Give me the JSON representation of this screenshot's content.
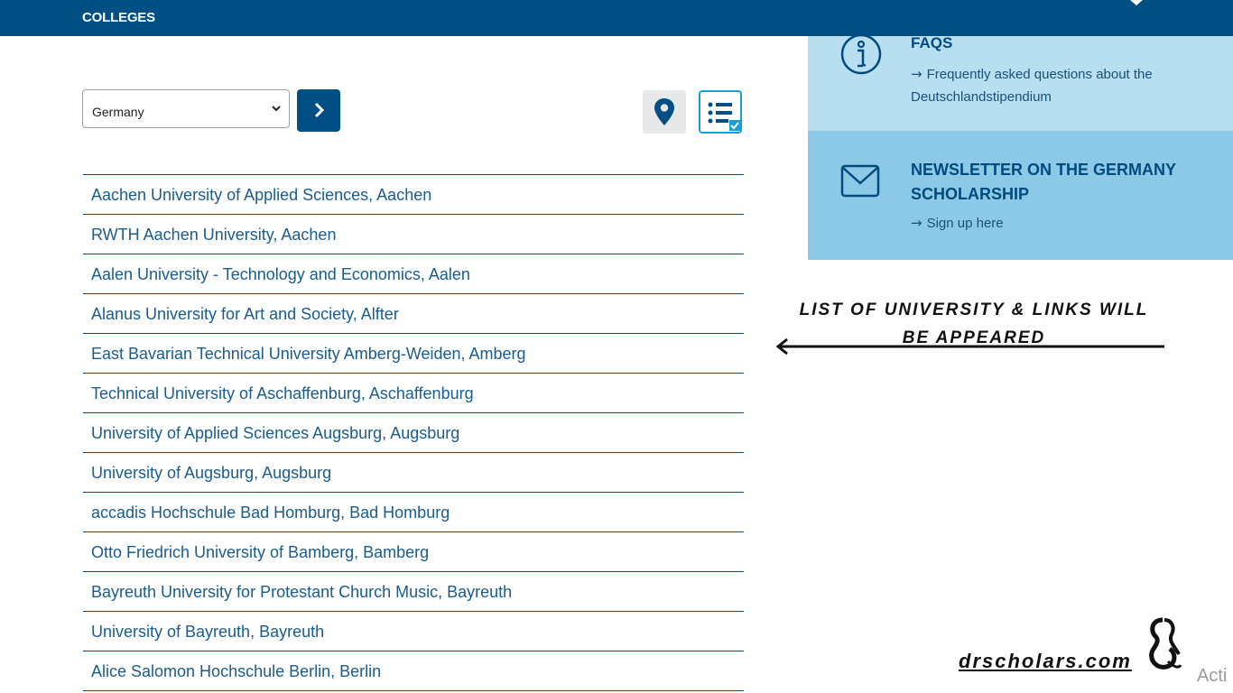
{
  "header": {
    "title": "COLLEGES"
  },
  "filter": {
    "selected": "Germany"
  },
  "universities": [
    "Aachen University of Applied Sciences, Aachen",
    "RWTH Aachen University, Aachen",
    "Aalen University - Technology and Economics, Aalen",
    "Alanus University for Art and Society, Alfter",
    "East Bavarian Technical University Amberg-Weiden, Amberg",
    "Technical University of Aschaffenburg, Aschaffenburg",
    "University of Applied Sciences Augsburg, Augsburg",
    "University of Augsburg, Augsburg",
    "accadis Hochschule Bad Homburg, Bad Homburg",
    "Otto Friedrich University of Bamberg, Bamberg",
    "Bayreuth University for Protestant Church Music, Bayreuth",
    "University of Bayreuth, Bayreuth",
    "Alice Salomon Hochschule Berlin, Berlin"
  ],
  "sidebar": {
    "faq": {
      "title": "FAQS",
      "link": "Frequently asked questions about the Deutschlandstipendium"
    },
    "newsletter": {
      "title": "NEWSLETTER ON THE GERMANY SCHOLARSHIP",
      "link": "Sign up here"
    }
  },
  "annotation": {
    "text": "LIST OF UNIVERSITY & LINKS WILL BE APPEARED"
  },
  "watermark": {
    "site": "drscholars.com",
    "activate": "Acti"
  },
  "colors": {
    "primary": "#004f84",
    "accent": "#16a0d8",
    "faq_bg": "#b8dff0",
    "newsletter_bg": "#8cc9e6"
  },
  "icons": [
    "chevron-down-icon",
    "chevron-right-icon",
    "map-pin-icon",
    "list-view-icon",
    "info-icon",
    "mail-icon",
    "arrow-right-icon",
    "arrow-left-icon"
  ]
}
